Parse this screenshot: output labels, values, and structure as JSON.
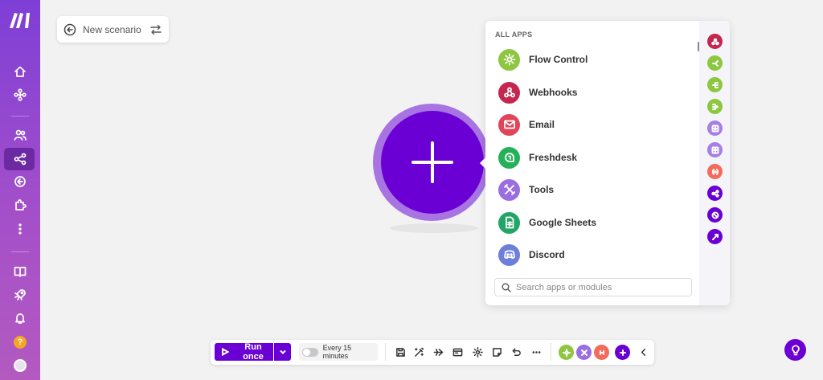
{
  "colors": {
    "brand": "#6a00d4",
    "sidebar_top": "#7e3fd6",
    "sidebar_bottom": "#b35ac0",
    "canvas": "#f2f2f3"
  },
  "sidebar": {
    "items": [
      {
        "icon": "home-icon"
      },
      {
        "icon": "modules-icon"
      },
      {
        "icon": "team-icon"
      },
      {
        "icon": "scenarios-icon",
        "active": true
      },
      {
        "icon": "connections-icon"
      },
      {
        "icon": "puzzle-icon"
      },
      {
        "icon": "more-icon"
      },
      {
        "icon": "docs-icon"
      },
      {
        "icon": "rocket-icon"
      },
      {
        "icon": "bell-icon"
      },
      {
        "icon": "help-icon",
        "label": "?"
      },
      {
        "icon": "avatar"
      }
    ]
  },
  "header": {
    "scenario_name": "New scenario"
  },
  "apps_panel": {
    "title": "ALL APPS",
    "apps": [
      {
        "label": "Flow Control",
        "icon": "gear-icon",
        "color": "#8dc63f"
      },
      {
        "label": "Webhooks",
        "icon": "webhook-icon",
        "color": "#c4264f"
      },
      {
        "label": "Email",
        "icon": "mail-icon",
        "color": "#e0455a"
      },
      {
        "label": "Freshdesk",
        "icon": "freshdesk-icon",
        "color": "#25b15a"
      },
      {
        "label": "Tools",
        "icon": "tools-icon",
        "color": "#9a6ee0"
      },
      {
        "label": "Google Sheets",
        "icon": "sheets-icon",
        "color": "#22a565"
      },
      {
        "label": "Discord",
        "icon": "discord-icon",
        "color": "#6d7fd8"
      }
    ],
    "search_placeholder": "Search apps or modules",
    "rail": [
      {
        "icon": "webhook-icon",
        "color": "#c4264f"
      },
      {
        "icon": "router-icon",
        "color": "#8dc63f"
      },
      {
        "icon": "iterator-icon",
        "color": "#8dc63f"
      },
      {
        "icon": "aggregator-icon",
        "color": "#8dc63f"
      },
      {
        "icon": "download-icon",
        "color": "#a47fe6"
      },
      {
        "icon": "upload-icon",
        "color": "#a47fe6"
      },
      {
        "icon": "variable-icon",
        "color": "#f26b5b"
      },
      {
        "icon": "share-icon",
        "color": "#6a00d4"
      },
      {
        "icon": "globe-icon",
        "color": "#6a00d4"
      },
      {
        "icon": "link-icon",
        "color": "#6a00d4"
      }
    ]
  },
  "toolbar": {
    "run_label": "Run once",
    "schedule_label": "Every 15 minutes",
    "icons": [
      "save-icon",
      "magic-wand-icon",
      "plane-icon",
      "notes-icon",
      "settings-icon",
      "sticky-note-icon",
      "undo-icon",
      "more-icon"
    ],
    "quick_modules": [
      {
        "icon": "gear-icon",
        "color": "#8dc63f"
      },
      {
        "icon": "tools-icon",
        "color": "#9a6ee0"
      },
      {
        "icon": "text-icon",
        "color": "#f26b5b"
      }
    ]
  }
}
